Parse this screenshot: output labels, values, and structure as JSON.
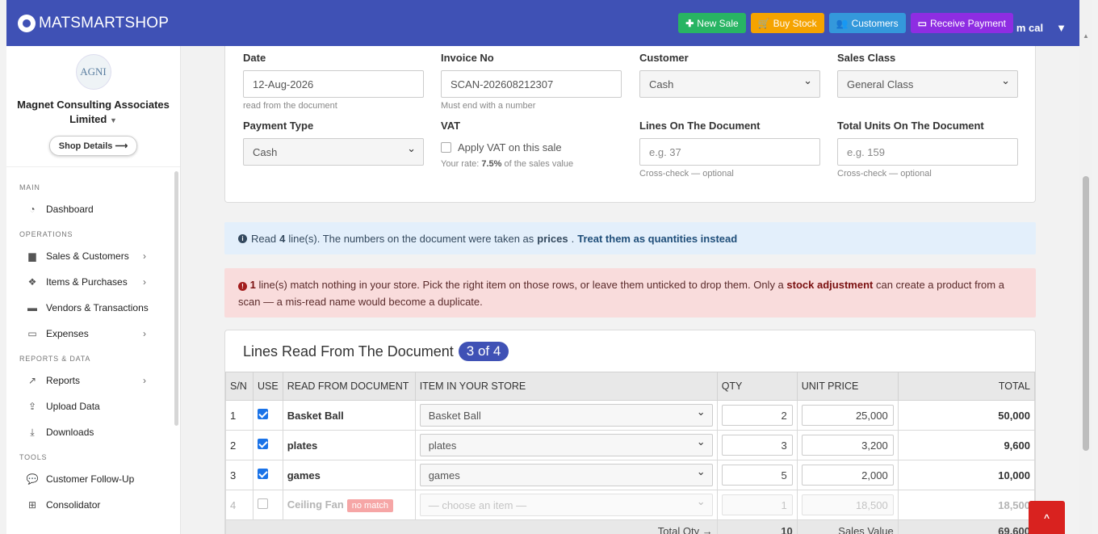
{
  "brand": {
    "name": "MATSMARTSHOP"
  },
  "topbar": {
    "buttons": [
      {
        "label": "New Sale",
        "icon": "plus-icon",
        "color": "#28b463"
      },
      {
        "label": "Buy Stock",
        "icon": "cart-icon",
        "color": "#f5a300"
      },
      {
        "label": "Customers",
        "icon": "users-icon",
        "color": "#3498db"
      },
      {
        "label": "Receive Payment",
        "icon": "card-icon",
        "color": "#8e2de2"
      }
    ],
    "user": "m cal"
  },
  "sidebar": {
    "logo_text": "AGNI",
    "org_name": "Magnet Consulting Associates Limited",
    "shop_details": "Shop Details",
    "sections": [
      {
        "title": "MAIN",
        "items": [
          {
            "label": "Dashboard",
            "icon": "dashboard-icon",
            "chevron": false
          }
        ]
      },
      {
        "title": "OPERATIONS",
        "items": [
          {
            "label": "Sales & Customers",
            "icon": "bag-icon",
            "chevron": true
          },
          {
            "label": "Items & Purchases",
            "icon": "cubes-icon",
            "chevron": true
          },
          {
            "label": "Vendors & Transactions",
            "icon": "truck-icon",
            "chevron": false
          },
          {
            "label": "Expenses",
            "icon": "card-icon",
            "chevron": true
          }
        ]
      },
      {
        "title": "REPORTS & DATA",
        "items": [
          {
            "label": "Reports",
            "icon": "chart-icon",
            "chevron": true
          },
          {
            "label": "Upload Data",
            "icon": "upload-icon",
            "chevron": false
          },
          {
            "label": "Downloads",
            "icon": "download-icon",
            "chevron": false
          }
        ]
      },
      {
        "title": "TOOLS",
        "items": [
          {
            "label": "Customer Follow-Up",
            "icon": "comment-icon",
            "chevron": false
          },
          {
            "label": "Consolidator",
            "icon": "sitemap-icon",
            "chevron": false
          }
        ]
      }
    ]
  },
  "form": {
    "date": {
      "label": "Date",
      "value": "12-Aug-2026",
      "hint": "read from the document"
    },
    "invoice": {
      "label": "Invoice No",
      "value": "SCAN-202608212307",
      "hint": "Must end with a number"
    },
    "customer": {
      "label": "Customer",
      "value": "Cash"
    },
    "sales_class": {
      "label": "Sales Class",
      "value": "General Class"
    },
    "payment_type": {
      "label": "Payment Type",
      "value": "Cash"
    },
    "vat": {
      "label": "VAT",
      "checkbox_label": "Apply VAT on this sale",
      "rate_prefix": "Your rate:",
      "rate": "7.5%",
      "rate_suffix": "of the sales value"
    },
    "lines": {
      "label": "Lines On The Document",
      "placeholder": "e.g. 37",
      "hint": "Cross-check — optional"
    },
    "units": {
      "label": "Total Units On The Document",
      "placeholder": "e.g. 159",
      "hint": "Cross-check — optional"
    }
  },
  "info_alert": {
    "pre": "Read",
    "count": "4",
    "mid": "line(s). The numbers on the document were taken as",
    "prices": "prices",
    "link": "Treat them as quantities instead"
  },
  "error_alert": {
    "count": "1",
    "text1": "line(s) match nothing in your store. Pick the right item on those rows, or leave them unticked to drop them. Only a",
    "bold": "stock adjustment",
    "text2": "can create a product from a scan — a mis-read name would become a duplicate."
  },
  "lines_table": {
    "title": "Lines Read From The Document",
    "badge": "3 of 4",
    "headers": [
      "S/N",
      "USE",
      "READ FROM DOCUMENT",
      "ITEM IN YOUR STORE",
      "QTY",
      "UNIT PRICE",
      "TOTAL"
    ],
    "rows": [
      {
        "sn": "1",
        "use": true,
        "read": "Basket Ball",
        "item": "Basket Ball",
        "qty": "2",
        "price": "25,000",
        "total": "50,000"
      },
      {
        "sn": "2",
        "use": true,
        "read": "plates",
        "item": "plates",
        "qty": "3",
        "price": "3,200",
        "total": "9,600"
      },
      {
        "sn": "3",
        "use": true,
        "read": "games",
        "item": "games",
        "qty": "5",
        "price": "2,000",
        "total": "10,000"
      },
      {
        "sn": "4",
        "use": false,
        "read": "Ceiling Fan",
        "badge": "no match",
        "item": "— choose an item —",
        "qty": "1",
        "price": "18,500",
        "total": "18,500"
      }
    ],
    "footer": {
      "qty_label": "Total Qty →",
      "qty": "10",
      "value_label": "Sales Value",
      "value": "69,600"
    }
  },
  "back_to_top": "^"
}
